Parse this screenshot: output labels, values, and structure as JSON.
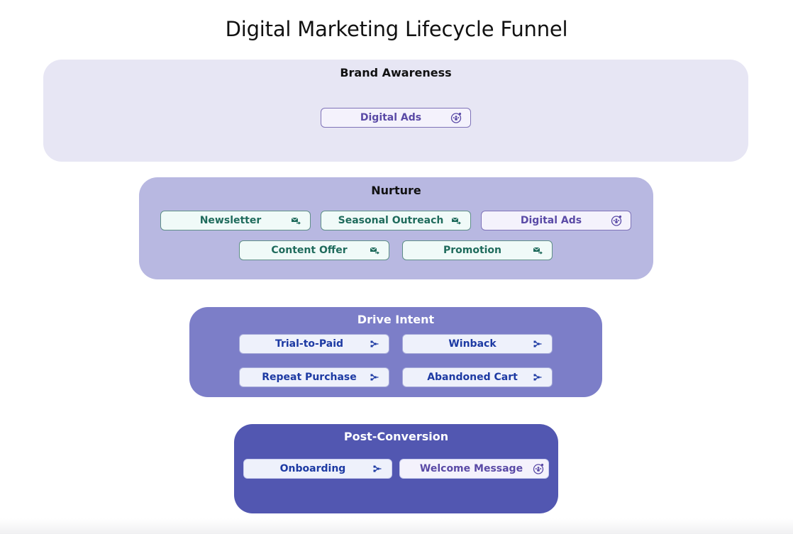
{
  "title": "Digital Marketing Lifecycle Funnel",
  "icons": {
    "ads": "audience-target-icon",
    "email": "email-send-icon",
    "flow": "workflow-icon"
  },
  "colors": {
    "awareness_bg": "#e7e6f4",
    "nurture_bg": "#b8b8e1",
    "intent_bg": "#7c7ec8",
    "post_bg": "#5257b1",
    "ads_text": "#5a4aa6",
    "email_text": "#1f6b5c",
    "flow_text": "#1d3aa3"
  },
  "stages": [
    {
      "name": "Brand Awareness",
      "items": [
        {
          "label": "Digital Ads",
          "type": "ads"
        }
      ]
    },
    {
      "name": "Nurture",
      "items": [
        {
          "label": "Newsletter",
          "type": "email"
        },
        {
          "label": "Seasonal Outreach",
          "type": "email"
        },
        {
          "label": "Digital Ads",
          "type": "ads"
        },
        {
          "label": "Content Offer",
          "type": "email"
        },
        {
          "label": "Promotion",
          "type": "email"
        }
      ]
    },
    {
      "name": "Drive Intent",
      "items": [
        {
          "label": "Trial-to-Paid",
          "type": "flow"
        },
        {
          "label": "Winback",
          "type": "flow"
        },
        {
          "label": "Repeat Purchase",
          "type": "flow"
        },
        {
          "label": "Abandoned Cart",
          "type": "flow"
        }
      ]
    },
    {
      "name": "Post-Conversion",
      "items": [
        {
          "label": "Onboarding",
          "type": "flow"
        },
        {
          "label": "Welcome Message",
          "type": "ads"
        }
      ]
    }
  ]
}
